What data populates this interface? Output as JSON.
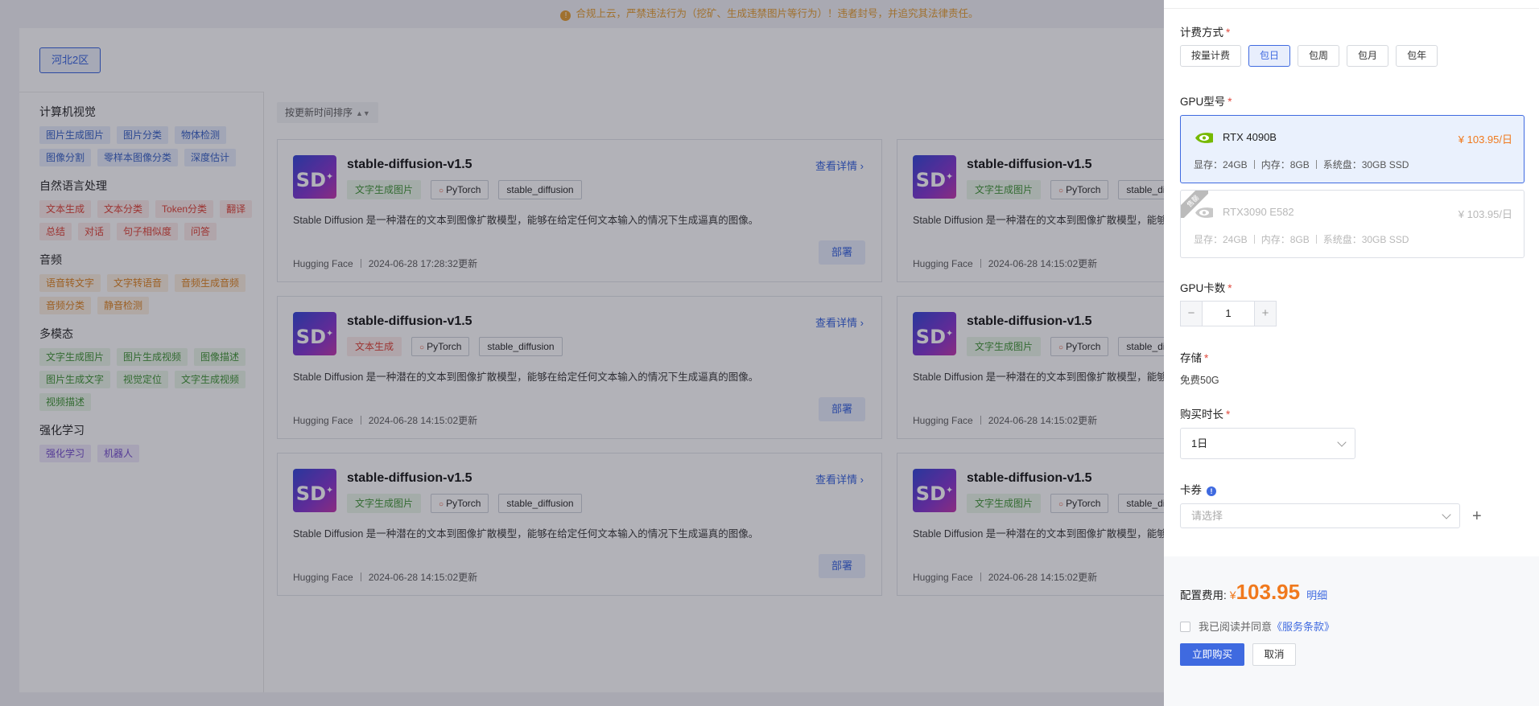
{
  "notice": "合规上云，严禁违法行为（挖矿、生成违禁图片等行为）！违者封号，并追究其法律责任。",
  "region": "河北2区",
  "sort_label": "按更新时间排序",
  "filters": [
    {
      "title": "计算机视觉",
      "color": "blue",
      "tags": [
        "图片生成图片",
        "图片分类",
        "物体检测",
        "图像分割",
        "零样本图像分类",
        "深度估计"
      ]
    },
    {
      "title": "自然语言处理",
      "color": "red",
      "tags": [
        "文本生成",
        "文本分类",
        "Token分类",
        "翻译",
        "总结",
        "对话",
        "句子相似度",
        "问答"
      ]
    },
    {
      "title": "音频",
      "color": "orange",
      "tags": [
        "语音转文字",
        "文字转语音",
        "音频生成音频",
        "音频分类",
        "静音检测"
      ]
    },
    {
      "title": "多模态",
      "color": "green",
      "tags": [
        "文字生成图片",
        "图片生成视频",
        "图像描述",
        "图片生成文字",
        "视觉定位",
        "文字生成视频",
        "视频描述"
      ]
    },
    {
      "title": "强化学习",
      "color": "purple",
      "tags": [
        "强化学习",
        "机器人"
      ]
    }
  ],
  "cards": [
    {
      "name": "stable-diffusion-v1.5",
      "task": "文字生成图片",
      "task_color": "green",
      "framework": "PyTorch",
      "lib": "stable_diffusion",
      "desc": "Stable Diffusion 是一种潜在的文本到图像扩散模型，能够在给定任何文本输入的情况下生成逼真的图像。",
      "source": "Hugging Face",
      "updated": "2024-06-28 17:28:32更新"
    },
    {
      "name": "stable-diffusion-v1.5",
      "task": "文字生成图片",
      "task_color": "green",
      "framework": "PyTorch",
      "lib": "stable_dif",
      "desc": "Stable Diffusion 是一种潜在的文本到图像扩散模型，能够在给定任何",
      "source": "Hugging Face",
      "updated": "2024-06-28 14:15:02更新"
    },
    {
      "name": "stable-diffusion-v1.5",
      "task": "文本生成",
      "task_color": "red",
      "framework": "PyTorch",
      "lib": "stable_diffusion",
      "desc": "Stable Diffusion 是一种潜在的文本到图像扩散模型，能够在给定任何文本输入的情况下生成逼真的图像。",
      "source": "Hugging Face",
      "updated": "2024-06-28 14:15:02更新"
    },
    {
      "name": "stable-diffusion-v1.5",
      "task": "文字生成图片",
      "task_color": "green",
      "framework": "PyTorch",
      "lib": "stable_dif",
      "desc": "Stable Diffusion 是一种潜在的文本到图像扩散模型，能够在给定任何",
      "source": "Hugging Face",
      "updated": "2024-06-28 14:15:02更新"
    },
    {
      "name": "stable-diffusion-v1.5",
      "task": "文字生成图片",
      "task_color": "green",
      "framework": "PyTorch",
      "lib": "stable_diffusion",
      "desc": "Stable Diffusion 是一种潜在的文本到图像扩散模型，能够在给定任何文本输入的情况下生成逼真的图像。",
      "source": "Hugging Face",
      "updated": "2024-06-28 14:15:02更新"
    },
    {
      "name": "stable-diffusion-v1.5",
      "task": "文字生成图片",
      "task_color": "green",
      "framework": "PyTorch",
      "lib": "stable_dif",
      "desc": "Stable Diffusion 是一种潜在的文本到图像扩散模型，能够在给定任何",
      "source": "Hugging Face",
      "updated": "2024-06-28 14:15:02更新"
    }
  ],
  "card_labels": {
    "detail": "查看详情",
    "deploy": "部署",
    "logo": "SD"
  },
  "drawer": {
    "billing_label": "计费方式",
    "billing_options": [
      "按量计费",
      "包日",
      "包周",
      "包月",
      "包年"
    ],
    "billing_selected": "包日",
    "gpu_label": "GPU型号",
    "gpus": [
      {
        "name": "RTX 4090B",
        "price": "¥ 103.95/日",
        "vram": "显存：24GB",
        "mem": "内存：8GB",
        "disk": "系统盘：30GB SSD",
        "selected": true,
        "disabled": false
      },
      {
        "name": "RTX3090 E582",
        "price": "¥ 103.95/日",
        "vram": "显存：24GB",
        "mem": "内存：8GB",
        "disk": "系统盘：30GB SSD",
        "selected": false,
        "disabled": true,
        "ribbon": "售罄"
      }
    ],
    "gpu_count_label": "GPU卡数",
    "gpu_count": "1",
    "storage_label": "存储",
    "storage_value": "免费50G",
    "duration_label": "购买时长",
    "duration_value": "1日",
    "coupon_label": "卡券",
    "coupon_placeholder": "请选择",
    "fee_label": "配置费用:",
    "fee_currency": "¥",
    "fee_amount": "103.95",
    "fee_detail": "明细",
    "agree_text": "我已阅读并同意",
    "agree_link": "《服务条款》",
    "buy_label": "立即购买",
    "cancel_label": "取消"
  },
  "colors": {
    "accent": "#3f6ae0",
    "price": "#f0791d",
    "required": "#e04b3f"
  }
}
